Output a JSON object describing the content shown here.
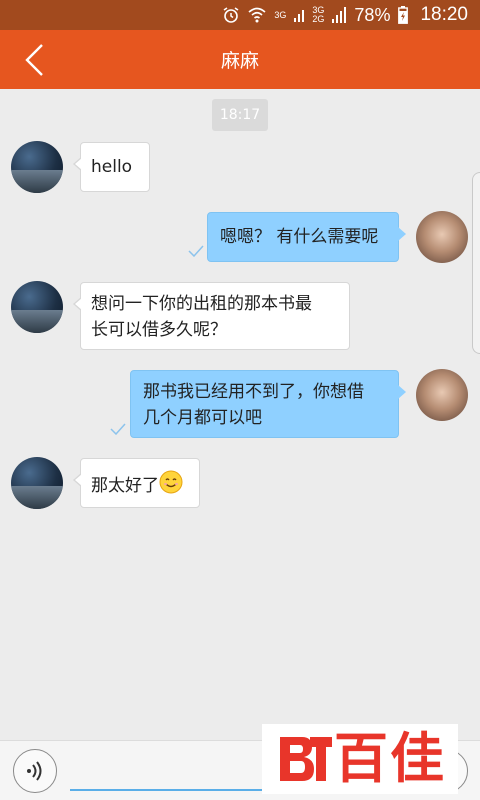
{
  "status_bar": {
    "network_1": "3G",
    "network_2_top": "3G",
    "network_2_bottom": "2G",
    "battery": "78%",
    "time": "18:20"
  },
  "header": {
    "title": "麻麻"
  },
  "chat": {
    "time_divider": "18:17",
    "messages": [
      {
        "side": "left",
        "text": "hello"
      },
      {
        "side": "right",
        "text": "嗯嗯？ 有什么需要呢"
      },
      {
        "side": "left",
        "text_line1": "想问一下你的出租的那本书最",
        "text_line2": "长可以借多久呢？"
      },
      {
        "side": "right",
        "text_line1": "那书我已经用不到了，你想借",
        "text_line2": "几个月都可以吧"
      },
      {
        "side": "left",
        "text": "那太好了",
        "emoji": "smiling-face"
      }
    ]
  },
  "input": {
    "placeholder": "",
    "value": ""
  },
  "watermark": {
    "text": "百佳",
    "brand_mark": "BT"
  },
  "colors": {
    "header": "#e6561f",
    "status_bar": "#a24a1e",
    "bubble_out": "#8fd0ff",
    "bubble_in": "#ffffff",
    "watermark": "#e8352a"
  }
}
